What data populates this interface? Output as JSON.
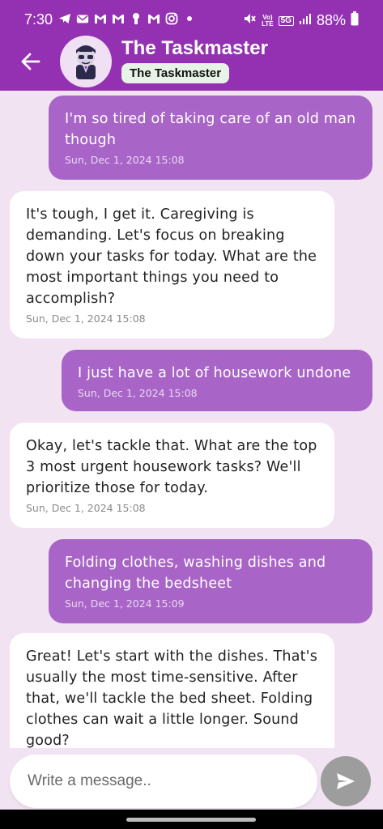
{
  "status_bar": {
    "time": "7:30",
    "battery_percent": "88%",
    "left_icons": [
      "telegram-icon",
      "mail-icon",
      "gmail-icon",
      "gmail-icon",
      "keyhole-icon",
      "gmail-icon",
      "instagram-icon",
      "dot-icon"
    ],
    "right_icons": [
      "mute-icon",
      "volte-icon",
      "5g-icon",
      "signal-icon",
      "battery-icon"
    ],
    "volte_line1": "Vo)",
    "volte_line2": "LTE",
    "network": "5G"
  },
  "header": {
    "title": "The Taskmaster",
    "chip_label": "The Taskmaster",
    "avatar_icon": "character-avatar-icon"
  },
  "messages": [
    {
      "sender": "user",
      "text": "I'm so tired of taking care of an old man though",
      "timestamp": "Sun, Dec 1, 2024 15:08"
    },
    {
      "sender": "bot",
      "text": "It's tough, I get it.  Caregiving is demanding. Let's focus on breaking down your tasks for today. What are the most important things you need to accomplish?",
      "timestamp": "Sun, Dec 1, 2024 15:08"
    },
    {
      "sender": "user",
      "text": "I just have a lot of housework undone",
      "timestamp": "Sun, Dec 1, 2024 15:08"
    },
    {
      "sender": "bot",
      "text": "Okay, let's tackle that. What are the top 3 most urgent housework tasks? We'll prioritize those for today.",
      "timestamp": "Sun, Dec 1, 2024 15:08"
    },
    {
      "sender": "user",
      "text": "Folding clothes, washing dishes and changing the bedsheet",
      "timestamp": "Sun, Dec 1, 2024 15:09"
    },
    {
      "sender": "bot",
      "text": "Great!  Let's start with the dishes. That's usually the most time-sensitive. After that, we'll tackle the bed sheet. Folding clothes can wait a little longer. Sound good?",
      "timestamp": ""
    }
  ],
  "composer": {
    "placeholder": "Write a message..",
    "send_icon": "send-icon"
  },
  "colors": {
    "header": "#9431b3",
    "user_bubble": "#a865c7",
    "bot_bubble": "#ffffff",
    "background": "#f1e3f1",
    "send_button": "#9d9d9d"
  }
}
